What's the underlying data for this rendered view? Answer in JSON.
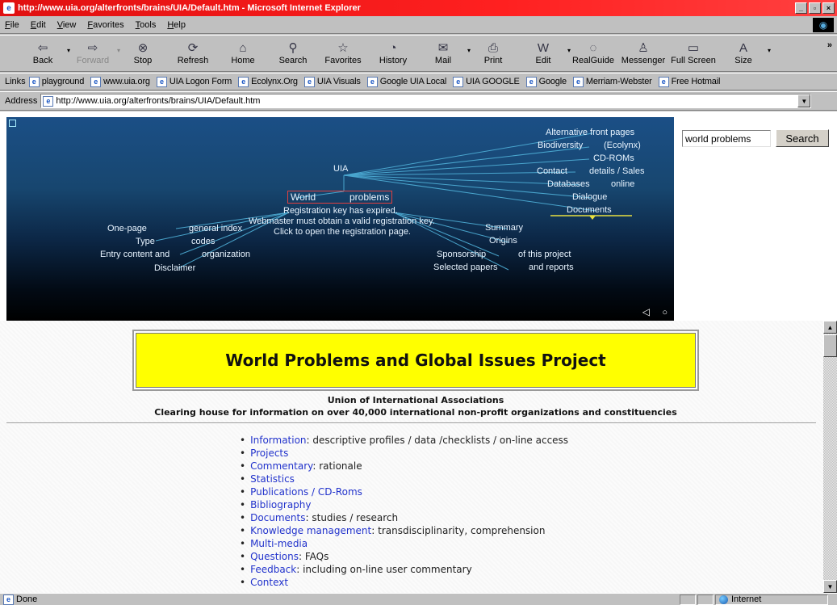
{
  "window": {
    "title": "http://www.uia.org/alterfronts/brains/UIA/Default.htm - Microsoft Internet Explorer",
    "minimize": "_",
    "maximize": "▫",
    "close": "×"
  },
  "menu": [
    "File",
    "Edit",
    "View",
    "Favorites",
    "Tools",
    "Help"
  ],
  "toolbar": [
    {
      "label": "Back",
      "icon": "⇦"
    },
    {
      "label": "Forward",
      "icon": "⇨"
    },
    {
      "label": "Stop",
      "icon": "⊗"
    },
    {
      "label": "Refresh",
      "icon": "⟳"
    },
    {
      "label": "Home",
      "icon": "⌂"
    },
    {
      "label": "Search",
      "icon": "⚲"
    },
    {
      "label": "Favorites",
      "icon": "☆"
    },
    {
      "label": "History",
      "icon": "◔"
    },
    {
      "label": "Mail",
      "icon": "✉"
    },
    {
      "label": "Print",
      "icon": "⎙"
    },
    {
      "label": "Edit",
      "icon": "W"
    },
    {
      "label": "RealGuide",
      "icon": "◌"
    },
    {
      "label": "Messenger",
      "icon": "♙"
    },
    {
      "label": "Full Screen",
      "icon": "▭"
    },
    {
      "label": "Size",
      "icon": "A"
    }
  ],
  "links": {
    "label": "Links",
    "items": [
      "playground",
      "www.uia.org",
      "UIA Logon Form",
      "Ecolynx.Org",
      "UIA Visuals",
      "Google UIA Local",
      "UIA GOOGLE",
      "Google",
      "Merriam-Webster",
      "Free Hotmail"
    ]
  },
  "address": {
    "label": "Address",
    "url": "http://www.uia.org/alterfronts/brains/UIA/Default.htm"
  },
  "map": {
    "nodes": {
      "uia": "UIA",
      "world": "World",
      "problems": "problems",
      "alt_front": "Alternative front pages",
      "biodiversity": "Biodiversity",
      "ecolynx": "(Ecolynx)",
      "cdroms": "CD-ROMs",
      "contact": "Contact",
      "details_sales": "details / Sales",
      "databases": "Databases",
      "online": "online",
      "dialogue": "Dialogue",
      "documents": "Documents",
      "summary": "Summary",
      "origins": "Origins",
      "sponsorship": "Sponsorship",
      "of_this_project": "of this project",
      "selected_papers": "Selected papers",
      "and_reports": "and reports",
      "one_page": "One-page",
      "general_index": "general index",
      "type": "Type",
      "codes": "codes",
      "entry_content": "Entry content and",
      "organization": "organization",
      "disclaimer": "Disclaimer"
    },
    "notice": [
      "Registration key has expired.",
      "Webmaster must obtain a valid registration key.",
      "Click to open the registration page."
    ],
    "nav_back": "◁",
    "nav_home": "○"
  },
  "search": {
    "value": "world problems",
    "button": "Search"
  },
  "page": {
    "title": "World Problems and Global Issues Project",
    "org": "Union of International Associations",
    "subtitle": "Clearing house for information on over 40,000 international non-profit organizations and constituencies",
    "list": [
      {
        "link": "Information",
        "rest": ": descriptive profiles / data /checklists / on-line access"
      },
      {
        "link": "Projects",
        "rest": ""
      },
      {
        "link": "Commentary",
        "rest": ": rationale"
      },
      {
        "link": "Statistics",
        "rest": ""
      },
      {
        "link": "Publications / CD-Roms",
        "rest": ""
      },
      {
        "link": "Bibliography",
        "rest": ""
      },
      {
        "link": "Documents",
        "rest": ": studies / research"
      },
      {
        "link": "Knowledge management",
        "rest": ": transdisciplinarity, comprehension"
      },
      {
        "link": "Multi-media",
        "rest": ""
      },
      {
        "link": "Questions",
        "rest": ": FAQs"
      },
      {
        "link": "Feedback",
        "rest": ": including on-line user commentary"
      },
      {
        "link": "Context",
        "rest": ""
      }
    ]
  },
  "status": {
    "text": "Done",
    "zone": "Internet"
  },
  "colors": {
    "titlebar": "#e01010",
    "banner": "#ffff00",
    "link": "#2233cc",
    "map_line": "#4fb0d8"
  }
}
